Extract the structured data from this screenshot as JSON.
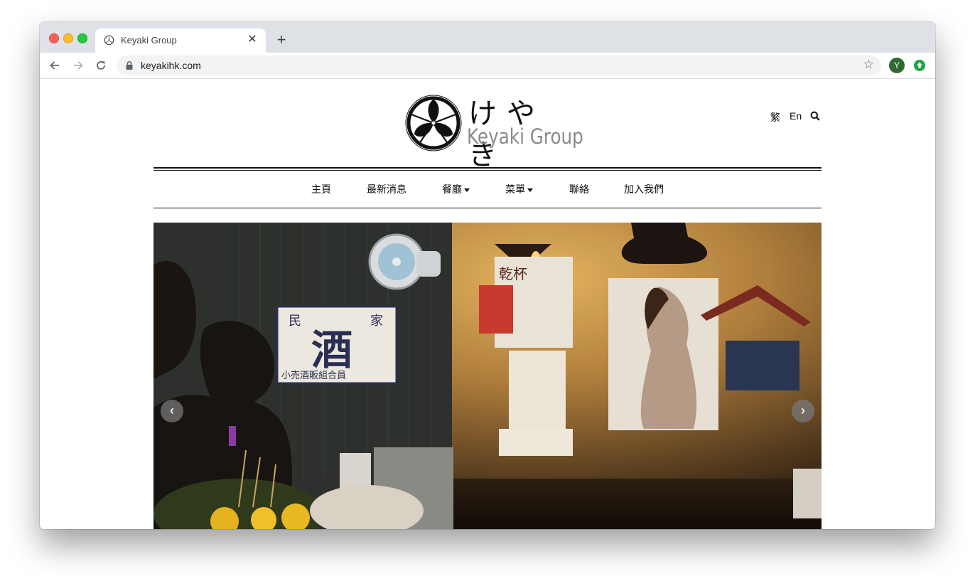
{
  "browser": {
    "tab_title": "Keyaki Group",
    "url": "keyakihk.com",
    "new_tab_label": "+",
    "close_tab_label": "✕",
    "profile_initial": "Y",
    "icons": [
      "back-icon",
      "forward-icon",
      "reload-icon",
      "lock-icon",
      "star-icon",
      "extension-icon"
    ]
  },
  "site": {
    "logo_text_jp": "けやき",
    "logo_text_en": "Keyaki Group",
    "lang_trad": "繁",
    "lang_en": "En",
    "nav": [
      {
        "label": "主頁"
      },
      {
        "label": "最新消息"
      },
      {
        "label": "餐廳"
      },
      {
        "label": "菜單"
      },
      {
        "label": "聯絡"
      },
      {
        "label": "加入我們"
      }
    ],
    "carousel": {
      "prev": "‹",
      "next": "›"
    },
    "poster_text": {
      "sake_sign_top_left": "民",
      "sake_sign_top_right": "家",
      "sake_sign_main": "酒",
      "sake_sign_bottom": "小売酒販組合員",
      "kanpai_poster": "乾杯"
    }
  },
  "colors": {
    "tabstrip": "#dee1e6",
    "accent_avatar": "#2e6b2e",
    "extension": "#1ea446",
    "logo_grey": "#8a8a8a"
  }
}
